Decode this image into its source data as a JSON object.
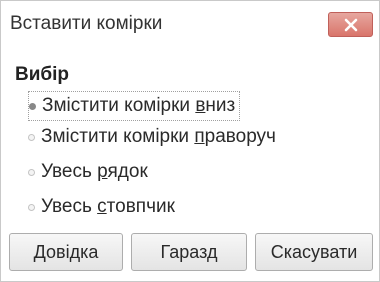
{
  "dialog": {
    "title": "Вставити комірки",
    "close_icon": "close-icon",
    "accent_close": "#d9756b"
  },
  "group": {
    "label": "Вибір",
    "options": [
      {
        "pre": "Змістити комірки ",
        "u": "в",
        "post": "низ",
        "selected": true
      },
      {
        "pre": "Змістити комірки ",
        "u": "п",
        "post": "раворуч",
        "selected": false
      },
      {
        "pre": "Увесь ",
        "u": "р",
        "post": "ядок",
        "selected": false
      },
      {
        "pre": "Увесь ",
        "u": "с",
        "post": "товпчик",
        "selected": false
      }
    ]
  },
  "buttons": {
    "help": {
      "u": "Д",
      "post": "овідка"
    },
    "ok": {
      "text": "Гаразд"
    },
    "cancel": {
      "text": "Скасувати"
    }
  }
}
